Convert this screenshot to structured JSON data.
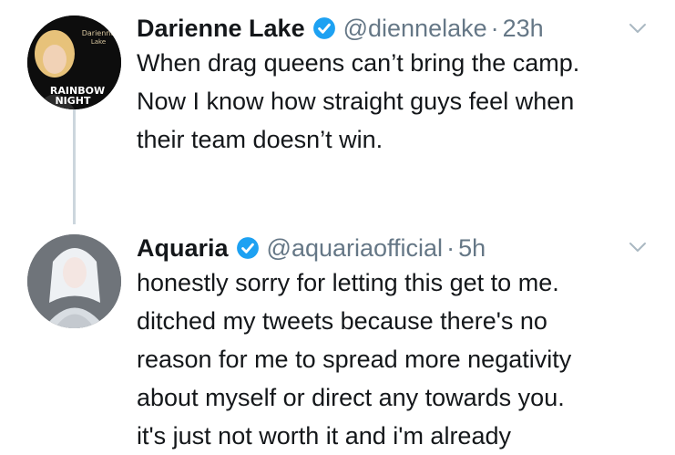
{
  "tweets": [
    {
      "name": "Darienne Lake",
      "handle": "@diennelake",
      "separator": "·",
      "time": "23h",
      "avatar_text": [
        "Darienne",
        "Lake",
        "RAINBOW",
        "NIGHT"
      ],
      "lines": [
        "When drag queens can’t bring the camp.",
        "Now I know how straight guys feel when",
        "their team doesn’t win."
      ]
    },
    {
      "name": "Aquaria",
      "handle": "@aquariaofficial",
      "separator": "·",
      "time": "5h",
      "lines": [
        "honestly sorry for letting this get to me.",
        "ditched my tweets because there's no",
        "reason for me to spread more negativity",
        "about myself or direct any towards you.",
        "it's just not worth it and i'm already"
      ]
    }
  ],
  "icons": {
    "verified": "verified-badge-icon",
    "more": "chevron-down-icon"
  },
  "colors": {
    "verified": "#1da1f2",
    "secondary_text": "#657786",
    "thread_line": "#ccd6dd"
  }
}
